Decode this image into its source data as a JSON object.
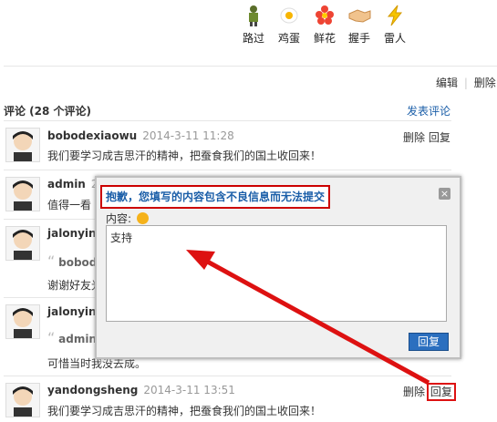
{
  "reactions": [
    {
      "label": "路过",
      "icon": "soldier-icon"
    },
    {
      "label": "鸡蛋",
      "icon": "egg-icon"
    },
    {
      "label": "鲜花",
      "icon": "flower-icon"
    },
    {
      "label": "握手",
      "icon": "handshake-icon"
    },
    {
      "label": "雷人",
      "icon": "lightning-icon"
    }
  ],
  "admin_links": {
    "edit": "编辑",
    "sep": "|",
    "delete": "删除"
  },
  "comments_header": {
    "title": "评论 (28 个评论)",
    "post_link": "发表评论"
  },
  "comments": [
    {
      "user": "bobodexiaowu",
      "date": "2014-3-11 11:28",
      "text": "我们要学习成吉思汗的精神，把蚕食我们的国土收回来！",
      "delete": "删除",
      "reply": "回复"
    },
    {
      "user": "admin",
      "date": "20",
      "text": "值得一看"
    },
    {
      "user": "jalonyin",
      "date": "2",
      "quote_user": "bobode",
      "text": "谢谢好友光"
    },
    {
      "user": "jalonyin",
      "date": "2",
      "quote_user": "admin:",
      "text": "可惜当时我没去成。"
    },
    {
      "user": "yandongsheng",
      "date": "2014-3-11 13:51",
      "text": "我们要学习成吉思汗的精神，把蚕食我们的国土收回来！",
      "delete": "删除",
      "reply": "回复"
    }
  ],
  "dialog": {
    "title": "抱歉，您填写的内容包含不良信息而无法提交",
    "close": "×",
    "content_label": "内容:",
    "content_value": "支持",
    "submit": "回复"
  },
  "colors": {
    "annotation_red": "#dd1111",
    "link_blue": "#1a5ea8",
    "button_blue": "#2b6fbf"
  }
}
